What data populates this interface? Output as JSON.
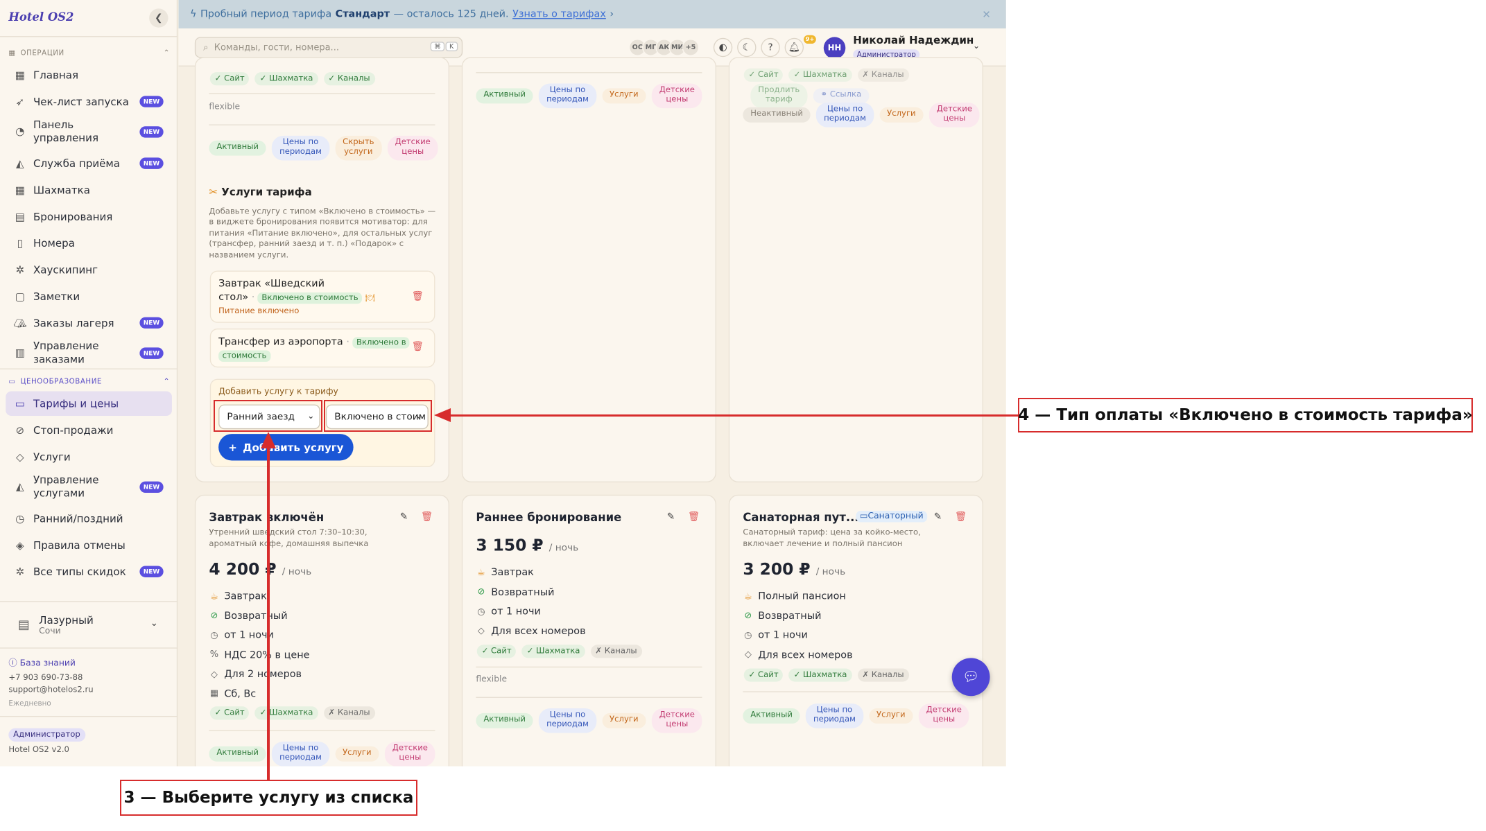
{
  "app": {
    "logo": "Hotel OS2"
  },
  "banner": {
    "pre": "Пробный период тарифа",
    "plan": "Стандарт",
    "post": "— осталось 125 дней.",
    "link": "Узнать о тарифах"
  },
  "search": {
    "placeholder": "Команды, гости, номера...",
    "k1": "⌘",
    "k2": "K"
  },
  "header": {
    "avatars": [
      "ОС",
      "МГ",
      "АК",
      "МИ",
      "+5"
    ],
    "notif_count": "9+",
    "user_initials": "НН",
    "user_name": "Николай Надеждин",
    "user_role": "Администратор"
  },
  "sidebar": {
    "section_ops": "ОПЕРАЦИИ",
    "ops": [
      {
        "label": "Главная",
        "icon": "grid-icon",
        "new": false
      },
      {
        "label": "Чек-лист запуска",
        "icon": "rocket-icon",
        "new": true
      },
      {
        "label": "Панель управления",
        "icon": "gauge-icon",
        "new": true
      },
      {
        "label": "Служба приёма",
        "icon": "bell-icon",
        "new": true
      },
      {
        "label": "Шахматка",
        "icon": "table-icon",
        "new": false
      },
      {
        "label": "Бронирования",
        "icon": "clipboard-icon",
        "new": false
      },
      {
        "label": "Номера",
        "icon": "door-icon",
        "new": false
      },
      {
        "label": "Хаускипинг",
        "icon": "sparkle-icon",
        "new": false
      },
      {
        "label": "Заметки",
        "icon": "note-icon",
        "new": false
      },
      {
        "label": "Заказы лагеря",
        "icon": "tent-icon",
        "new": true
      },
      {
        "label": "Управление заказами",
        "icon": "receipt-icon",
        "new": true
      }
    ],
    "section_pricing": "ЦЕНООБРАЗОВАНИЕ",
    "pricing": [
      {
        "label": "Тарифы и цены",
        "icon": "card-icon",
        "new": false
      },
      {
        "label": "Стоп-продажи",
        "icon": "ban-icon",
        "new": false
      },
      {
        "label": "Услуги",
        "icon": "tag-icon",
        "new": false
      },
      {
        "label": "Управление услугами",
        "icon": "bell-icon",
        "new": true
      },
      {
        "label": "Ранний/поздний",
        "icon": "clock-icon",
        "new": false
      },
      {
        "label": "Правила отмены",
        "icon": "shield-icon",
        "new": false
      },
      {
        "label": "Все типы скидок",
        "icon": "sparkle-icon",
        "new": true
      }
    ],
    "new_label": "NEW",
    "hotel_name": "Лазурный",
    "hotel_city": "Сочи",
    "kb": "База знаний",
    "phone": "+7 903 690-73-88",
    "email": "support@hotelos2.ru",
    "hours": "Ежедневно",
    "role": "Администратор",
    "version": "Hotel OS2 v2.0"
  },
  "common": {
    "site": "✓ Сайт",
    "chess": "✓ Шахматка",
    "channels": "✓ Каналы",
    "channels_off": "✗ Каналы",
    "flexible": "flexible",
    "active": "Активный",
    "inactive": "Неактивный",
    "period_prices_1": "Цены по",
    "period_prices_2": "периодам",
    "hide_1": "Скрыть",
    "hide_2": "услуги",
    "services": "Услуги",
    "kids_1": "Детские",
    "kids_2": "цены",
    "extend_1": "Продлить",
    "extend_2": "тариф",
    "link": "Ссылка",
    "per_night": "/ ночь"
  },
  "services_panel": {
    "title": "Услуги тарифа",
    "desc": "Добавьте услугу с типом «Включено в стоимость» — в виджете бронирования появится мотиватор: для питания «Питание включено», для остальных услуг (трансфер, ранний заезд и т. п.) «Подарок» с названием услуги.",
    "item1_name_1": "Завтрак «Шведский",
    "item1_name_2": "стол»",
    "item1_badge": "Включено в стоимость",
    "item1_note": "Питание включено",
    "item2_name": "Трансфер из аэропорта",
    "item2_badge_1": "Включено в",
    "item2_badge_2": "стоимость",
    "add_label": "Добавить услугу к тарифу",
    "select_service": "Ранний заезд",
    "select_type": "Включено в стоим",
    "add_button": "Добавить услугу"
  },
  "cards": [
    {
      "title": "Завтрак включён",
      "desc_1": "Утренний шведский стол 7:30–10:30,",
      "desc_2": "ароматный кофе, домашняя выпечка",
      "price": "4 200 ₽",
      "features": [
        "Завтрак",
        "Возвратный",
        "от 1 ночи",
        "НДС 20% в цене",
        "Для 2 номеров",
        "Сб, Вс"
      ]
    },
    {
      "title": "Раннее бронирование",
      "price": "3 150 ₽",
      "features": [
        "Завтрак",
        "Возвратный",
        "от 1 ночи",
        "Для всех номеров"
      ]
    },
    {
      "title": "Санаторная пут...",
      "badge": "Санаторный",
      "desc_1": "Санаторный тариф: цена за койко-место,",
      "desc_2": "включает лечение и полный пансион",
      "price": "3 200 ₽",
      "features": [
        "Полный пансион",
        "Возвратный",
        "от 1 ночи",
        "Для всех номеров"
      ]
    }
  ],
  "annotations": {
    "step3": "3 — Выберите услугу из списка",
    "step4": "4 — Тип оплаты «Включено в стоимость тарифа»"
  },
  "colors": {
    "accent": "#4b3fb0",
    "primary_button": "#1a56d6",
    "annotation": "#d72c2c"
  }
}
